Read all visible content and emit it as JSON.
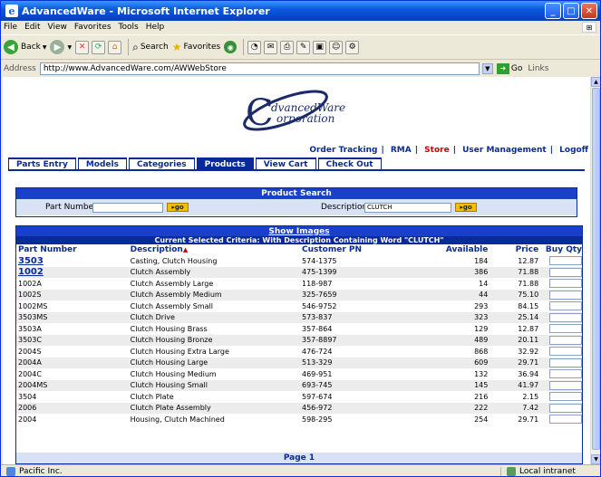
{
  "window": {
    "title": "AdvancedWare - Microsoft Internet Explorer",
    "ie_glyph": "e"
  },
  "menu": [
    "File",
    "Edit",
    "View",
    "Favorites",
    "Tools",
    "Help"
  ],
  "toolbar": {
    "back": "Back",
    "search": "Search",
    "favorites": "Favorites"
  },
  "address": {
    "label": "Address",
    "url": "http://www.AdvancedWare.com/AWWebStore",
    "go": "Go",
    "links": "Links"
  },
  "logo": {
    "line1": "dvancedWare",
    "line2": "orporation"
  },
  "topnav": [
    {
      "label": "Order Tracking"
    },
    {
      "label": "RMA"
    },
    {
      "label": "Store"
    },
    {
      "label": "User Management"
    },
    {
      "label": "Logoff"
    }
  ],
  "tabs": [
    "Parts Entry",
    "Models",
    "Categories",
    "Products",
    "View Cart",
    "Check Out"
  ],
  "search": {
    "title": "Product Search",
    "part_label": "Part Number",
    "part_value": "",
    "desc_label": "Description",
    "desc_value": "CLUTCH",
    "go_label": "go"
  },
  "results": {
    "show_images": "Show Images",
    "criteria": "Current Selected Criteria: With Description Containing Word \"CLUTCH\"",
    "headers": {
      "part": "Part Number",
      "desc": "Description",
      "cust": "Customer PN",
      "avail": "Available",
      "price": "Price",
      "qty": "Buy Qty"
    },
    "rows": [
      {
        "part": "3503",
        "desc": "Casting, Clutch Housing",
        "cust": "574-1375",
        "avail": "184",
        "price": "12.87"
      },
      {
        "part": "1002",
        "desc": "Clutch Assembly",
        "cust": "475-1399",
        "avail": "386",
        "price": "71.88"
      },
      {
        "part": "1002A",
        "desc": "Clutch Assembly Large",
        "cust": "118-987",
        "avail": "14",
        "price": "71.88"
      },
      {
        "part": "1002S",
        "desc": "Clutch Assembly Medium",
        "cust": "325-7659",
        "avail": "44",
        "price": "75.10"
      },
      {
        "part": "1002MS",
        "desc": "Clutch Assembly Small",
        "cust": "546-9752",
        "avail": "293",
        "price": "84.15"
      },
      {
        "part": "3503MS",
        "desc": "Clutch Drive",
        "cust": "573-837",
        "avail": "323",
        "price": "25.14"
      },
      {
        "part": "3503A",
        "desc": "Clutch Housing Brass",
        "cust": "357-864",
        "avail": "129",
        "price": "12.87"
      },
      {
        "part": "3503C",
        "desc": "Clutch Housing Bronze",
        "cust": "357-8897",
        "avail": "489",
        "price": "20.11"
      },
      {
        "part": "2004S",
        "desc": "Clutch Housing Extra Large",
        "cust": "476-724",
        "avail": "868",
        "price": "32.92"
      },
      {
        "part": "2004A",
        "desc": "Clutch Housing Large",
        "cust": "513-329",
        "avail": "609",
        "price": "29.71"
      },
      {
        "part": "2004C",
        "desc": "Clutch Housing Medium",
        "cust": "469-951",
        "avail": "132",
        "price": "36.94"
      },
      {
        "part": "2004MS",
        "desc": "Clutch Housing Small",
        "cust": "693-745",
        "avail": "145",
        "price": "41.97"
      },
      {
        "part": "3504",
        "desc": "Clutch Plate",
        "cust": "597-674",
        "avail": "216",
        "price": "2.15"
      },
      {
        "part": "2006",
        "desc": "Clutch Plate Assembly",
        "cust": "456-972",
        "avail": "222",
        "price": "7.42"
      },
      {
        "part": "2004",
        "desc": "Housing, Clutch Machined",
        "cust": "598-295",
        "avail": "254",
        "price": "29.71"
      }
    ],
    "page": "Page 1"
  },
  "status": {
    "left": "Pacific Inc.",
    "right": "Local intranet"
  },
  "colors": {
    "nav_blue": "#0a2a99",
    "header_blue": "#1a3fc9",
    "active_red": "#cc0000"
  }
}
